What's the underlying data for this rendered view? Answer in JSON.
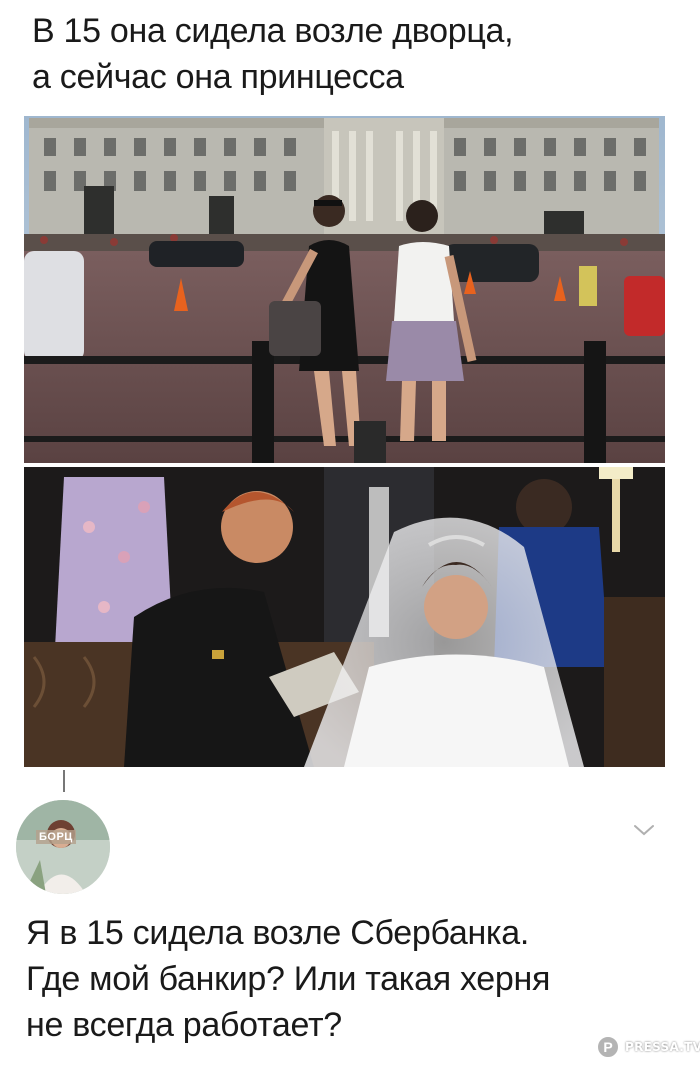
{
  "post": {
    "line1": "В 15 она сидела возле дворца,",
    "line2": "а сейчас она принцесса"
  },
  "images": {
    "top_photo_icon": "photo-palace-two-girls",
    "bottom_photo_icon": "photo-royal-wedding"
  },
  "comment": {
    "avatar_label": "БОРЦ",
    "line1": "Я в 15 сидела возле Сбербанка.",
    "line2": "Где мой банкир? Или такая херня",
    "line3": "не всегда работает?",
    "menu_icon": "chevron-down-icon"
  },
  "watermark": {
    "letter": "P",
    "text": "PRESSA.TV"
  },
  "colors": {
    "text": "#1a1a1a",
    "background": "#ffffff",
    "chevron": "#b0b0b0"
  }
}
